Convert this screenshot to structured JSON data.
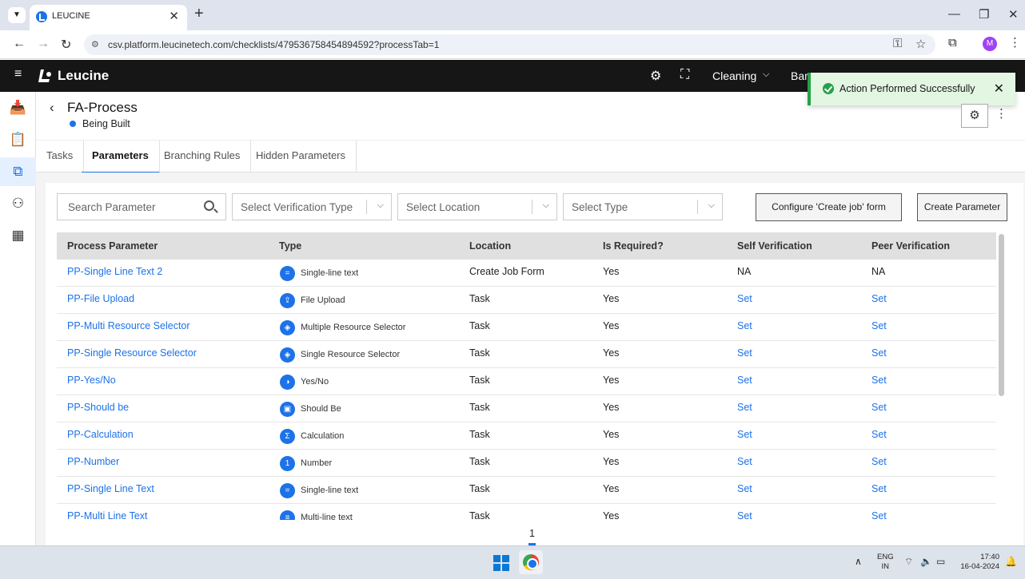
{
  "browser": {
    "tab_title": "LEUCINE",
    "url": "csv.platform.leucinetech.com/checklists/479536758454894592?processTab=1",
    "profile_initial": "M"
  },
  "header": {
    "logo": "Leucine",
    "facility": "Cleaning",
    "truncated_item": "Bar"
  },
  "toast": {
    "message": "Action Performed Successfully"
  },
  "process": {
    "title": "FA-Process",
    "status": "Being Built"
  },
  "tabs": [
    {
      "label": "Tasks"
    },
    {
      "label": "Parameters"
    },
    {
      "label": "Branching Rules"
    },
    {
      "label": "Hidden Parameters"
    }
  ],
  "filters": {
    "search_placeholder": "Search Parameter",
    "verification_type": "Select Verification Type",
    "location": "Select Location",
    "type": "Select Type",
    "configure_button": "Configure 'Create job' form",
    "create_button": "Create Parameter"
  },
  "table": {
    "columns": [
      "Process Parameter",
      "Type",
      "Location",
      "Is Required?",
      "Self Verification",
      "Peer Verification"
    ],
    "rows": [
      {
        "name": "PP-Single Line Text 2",
        "type": "Single-line text",
        "icon": "=",
        "location": "Create Job Form",
        "required": "Yes",
        "self": "NA",
        "peer": "NA"
      },
      {
        "name": "PP-File Upload",
        "type": "File Upload",
        "icon": "⇪",
        "location": "Task",
        "required": "Yes",
        "self": "Set",
        "peer": "Set"
      },
      {
        "name": "PP-Multi Resource Selector",
        "type": "Multiple Resource Selector",
        "icon": "◈",
        "location": "Task",
        "required": "Yes",
        "self": "Set",
        "peer": "Set"
      },
      {
        "name": "PP-Single Resource Selector",
        "type": "Single Resource Selector",
        "icon": "◈",
        "location": "Task",
        "required": "Yes",
        "self": "Set",
        "peer": "Set"
      },
      {
        "name": "PP-Yes/No",
        "type": "Yes/No",
        "icon": "◑",
        "location": "Task",
        "required": "Yes",
        "self": "Set",
        "peer": "Set"
      },
      {
        "name": "PP-Should be",
        "type": "Should Be",
        "icon": "▣",
        "location": "Task",
        "required": "Yes",
        "self": "Set",
        "peer": "Set"
      },
      {
        "name": "PP-Calculation",
        "type": "Calculation",
        "icon": "Σ",
        "location": "Task",
        "required": "Yes",
        "self": "Set",
        "peer": "Set"
      },
      {
        "name": "PP-Number",
        "type": "Number",
        "icon": "1",
        "location": "Task",
        "required": "Yes",
        "self": "Set",
        "peer": "Set"
      },
      {
        "name": "PP-Single Line Text",
        "type": "Single-line text",
        "icon": "=",
        "location": "Task",
        "required": "Yes",
        "self": "Set",
        "peer": "Set"
      },
      {
        "name": "PP-Multi Line Text",
        "type": "Multi-line text",
        "icon": "≡",
        "location": "Task",
        "required": "Yes",
        "self": "Set",
        "peer": "Set"
      }
    ]
  },
  "pagination": {
    "current": "1"
  },
  "taskbar": {
    "lang_top": "ENG",
    "lang_bottom": "IN",
    "time": "17:40",
    "date": "16-04-2024"
  }
}
